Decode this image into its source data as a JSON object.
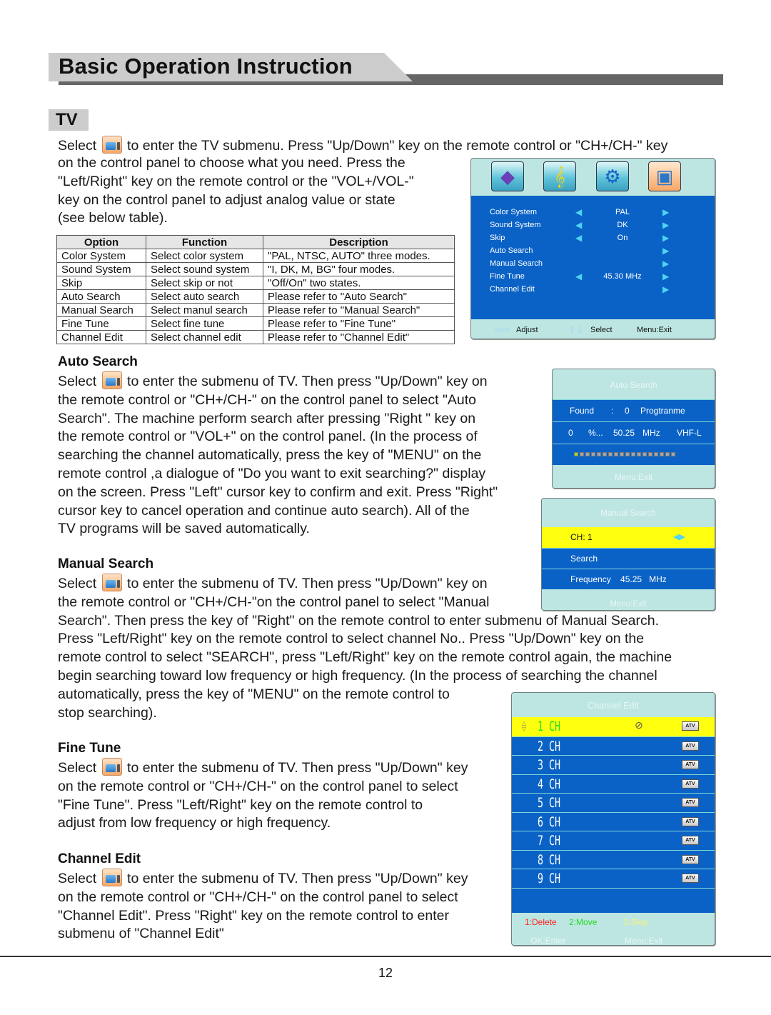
{
  "header": {
    "title": "Basic Operation Instruction",
    "section": "TV"
  },
  "intro": {
    "line1_pre": "Select",
    "line1_post": "to enter the TV submenu. Press \"Up/Down\" key on the remote control or \"CH+/CH-\" key",
    "lines": [
      "on the control panel to choose what you need. Press the",
      "\"Left/Right\" key on the remote control or the \"VOL+/VOL-\"",
      "key on the control panel to adjust analog  value or state",
      "(see below table)."
    ]
  },
  "table": {
    "headers": [
      "Option",
      "Function",
      "Description"
    ],
    "rows": [
      [
        "Color System",
        "Select color system",
        "\"PAL, NTSC, AUTO\" three modes."
      ],
      [
        "Sound System",
        "Select sound system",
        "\"I, DK, M, BG\" four modes."
      ],
      [
        "Skip",
        "Select skip or not",
        "\"Off/On\" two states."
      ],
      [
        "Auto Search",
        "Select auto search",
        "Please refer to \"Auto Search\""
      ],
      [
        "Manual Search",
        "Select manul search",
        "Please refer to \"Manual Search\""
      ],
      [
        "Fine Tune",
        "Select fine tune",
        "Please refer to \"Fine Tune\""
      ],
      [
        "Channel Edit",
        "Select channel edit",
        "Please refer to \"Channel Edit\""
      ]
    ]
  },
  "tv_menu": {
    "icons": [
      "picture-icon",
      "sound-icon",
      "setup-icon",
      "tv-icon"
    ],
    "items": [
      {
        "label": "Color System",
        "value": "PAL",
        "left_arrow": true
      },
      {
        "label": "Sound System",
        "value": "DK",
        "left_arrow": true
      },
      {
        "label": "Skip",
        "value": "On",
        "left_arrow": true
      },
      {
        "label": "Auto Search",
        "value": "",
        "left_arrow": false
      },
      {
        "label": "Manual Search",
        "value": "",
        "left_arrow": false
      },
      {
        "label": "Fine Tune",
        "value": "45.30 MHz",
        "left_arrow": true
      },
      {
        "label": "Channel Edit",
        "value": "",
        "left_arrow": false
      }
    ],
    "footer": {
      "adjust": "Adjust",
      "select": "Select",
      "exit": "Menu:Exit"
    }
  },
  "auto_search": {
    "heading": "Auto Search",
    "para": [
      "to enter the submenu of TV. Then press \"Up/Down\" key on",
      "the remote control or \"CH+/CH-\" on the control panel to select \"Auto",
      "Search\". The machine perform search after pressing \"Right \" key on",
      "the remote control or \"VOL+\" on the control panel. (In the process of",
      "searching the channel automatically, press the key of \"MENU\" on the",
      "remote control ,a dialogue of \"Do you want to exit searching?\" display",
      "on the screen. Press \"Left\" cursor key to confirm and exit. Press \"Right\"",
      "cursor key to cancel operation and continue auto search).  All of the",
      "TV programs will be saved automatically."
    ],
    "osd": {
      "title": "Auto Search",
      "found_label": "Found",
      "colon": ":",
      "found_count": "0",
      "found_unit": "Progtranme",
      "percent": "0",
      "percent_sign": "%...",
      "frequency": "50.25",
      "freq_unit": "MHz",
      "band": "VHF-L",
      "progress_segments_total": 18,
      "progress_segments_done": 1,
      "footer": "Menu:Exit"
    }
  },
  "manual_search": {
    "heading": "Manual Search",
    "para_narrow": [
      "to enter the submenu of TV. Then press \"Up/Down\" key on",
      "the remote control or \"CH+/CH-\"on the control panel to select \"Manual"
    ],
    "para_wide": [
      "Search\". Then press the key of \"Right\" on the remote control to enter submenu of Manual Search.",
      "Press \"Left/Right\" key on the remote control to select channel No.. Press \"Up/Down\" key on the",
      "remote control to select \"SEARCH\", press \"Left/Right\" key on the remote control again, the machine",
      "begin searching toward low frequency or high frequency. (In the process of searching the channel",
      "automatically, press the key of \"MENU\" on the remote control to",
      "stop searching)."
    ],
    "osd": {
      "title": "Manual Search",
      "ch_label": "CH:",
      "ch_value": "1",
      "search_label": "Search",
      "freq_label": "Frequency",
      "freq_value": "45.25",
      "freq_unit": "MHz",
      "footer": "Menu:Exit"
    }
  },
  "fine_tune": {
    "heading": "Fine Tune",
    "para": [
      "to enter the submenu of TV. Then press \"Up/Down\" key",
      "on the remote control or \"CH+/CH-\" on the control panel to select",
      "\"Fine Tune\".  Press \"Left/Right\" key on the remote control to",
      "adjust from low frequency or high frequency."
    ]
  },
  "channel_edit": {
    "heading": "Channel Edit",
    "para": [
      "to enter the submenu of TV. Then press \"Up/Down\" key",
      "on the remote control or \"CH+/CH-\" on the control panel to select",
      "\"Channel Edit\". Press \"Right\" key on the remote control to enter",
      "submenu of \"Channel Edit\""
    ],
    "osd": {
      "title": "Channel Edit",
      "channels": [
        "1 CH",
        "2 CH",
        "3 CH",
        "4 CH",
        "5 CH",
        "6 CH",
        "7 CH",
        "8 CH",
        "9 CH"
      ],
      "badge": "ATV",
      "selected_index": 0,
      "actions": {
        "delete": "1:Delete",
        "move": "2:Move",
        "skip": "3:Skip"
      },
      "footer": {
        "enter": "OK:Enter",
        "exit": "Menu:Exit"
      },
      "colors": {
        "delete": "#ff2020",
        "move": "#22dd22",
        "skip": "#f4f27a",
        "selected_bg": "#ffff10",
        "row_bg": "#0a62c6"
      }
    }
  },
  "select_word": "Select",
  "page_number": "12"
}
